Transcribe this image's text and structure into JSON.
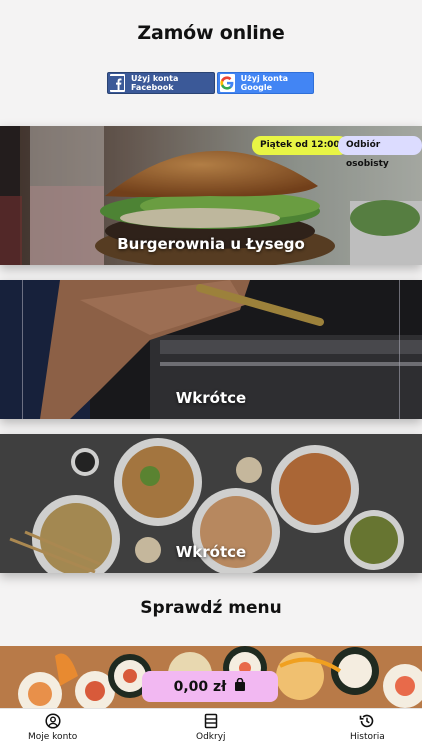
{
  "header": {
    "title": "Zamów online"
  },
  "login": {
    "facebook_label": "Użyj konta Facebook",
    "google_label": "Użyj konta Google"
  },
  "restaurants": [
    {
      "name": "Burgerownia u Łysego",
      "badges": [
        "Piątek od 12:00",
        "Odbiór osobisty"
      ]
    },
    {
      "name": "Wkrótce"
    },
    {
      "name": "Wkrótce"
    }
  ],
  "menu": {
    "title": "Sprawdź menu"
  },
  "cart": {
    "total": "0,00 zł"
  },
  "tabbar": {
    "account": "Moje konto",
    "discover": "Odkryj",
    "history": "Historia"
  },
  "colors": {
    "badge_yellow": "#e8f545",
    "badge_purple": "#dcdcff",
    "cart": "#f2b8f2",
    "facebook": "#3b5998",
    "google": "#4285f4"
  }
}
